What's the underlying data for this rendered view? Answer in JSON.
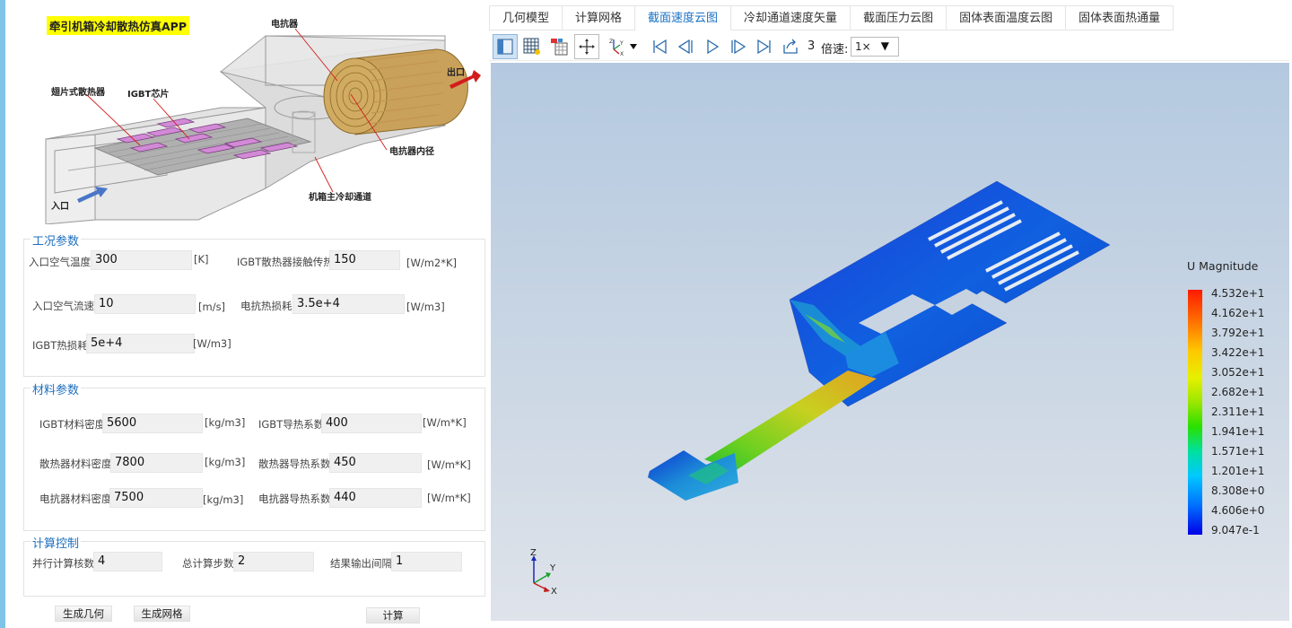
{
  "app_title": "牵引机箱冷却散热仿真APP",
  "geometry_labels": {
    "reactor": "电抗器",
    "outlet": "出口",
    "fin_heatsink": "翅片式散热器",
    "igbt_chip": "IGBT芯片",
    "reactor_inner": "电抗器内径",
    "inlet": "入口",
    "main_channel": "机箱主冷却通道"
  },
  "conditions": {
    "title": "工况参数",
    "fields": [
      {
        "label": "入口空气温度",
        "value": "300",
        "unit": "[K]"
      },
      {
        "label": "IGBT散热器接触传热",
        "value": "150",
        "unit": "[W/m2*K]"
      },
      {
        "label": "入口空气流速",
        "value": "10",
        "unit": "[m/s]"
      },
      {
        "label": "电抗热损耗",
        "value": "3.5e+4",
        "unit": "[W/m3]"
      },
      {
        "label": "IGBT热损耗",
        "value": "5e+4",
        "unit": "[W/m3]"
      }
    ]
  },
  "materials": {
    "title": "材料参数",
    "fields": [
      {
        "label": "IGBT材料密度",
        "value": "5600",
        "unit": "[kg/m3]"
      },
      {
        "label": "IGBT导热系数",
        "value": "400",
        "unit": "[W/m*K]"
      },
      {
        "label": "散热器材料密度",
        "value": "7800",
        "unit": "[kg/m3]"
      },
      {
        "label": "散热器导热系数",
        "value": "450",
        "unit": "[W/m*K]"
      },
      {
        "label": "电抗器材料密度",
        "value": "7500",
        "unit": "[kg/m3]"
      },
      {
        "label": "电抗器导热系数",
        "value": "440",
        "unit": "[W/m*K]"
      }
    ]
  },
  "compute": {
    "title": "计算控制",
    "fields": [
      {
        "label": "并行计算核数",
        "value": "4"
      },
      {
        "label": "总计算步数",
        "value": "2"
      },
      {
        "label": "结果输出间隔",
        "value": "1"
      }
    ]
  },
  "buttons": {
    "gen_geometry": "生成几何",
    "gen_mesh": "生成网格",
    "compute": "计算"
  },
  "tabs": [
    "几何模型",
    "计算网格",
    "截面速度云图",
    "冷却通道速度矢量",
    "截面压力云图",
    "固体表面温度云图",
    "固体表面热通量"
  ],
  "active_tab": 2,
  "toolbar": {
    "frame": "3",
    "speed_label": "倍速:",
    "speed_value": "1×"
  },
  "legend": {
    "title": "U Magnitude",
    "values": [
      "4.532e+1",
      "4.162e+1",
      "3.792e+1",
      "3.422e+1",
      "3.052e+1",
      "2.682e+1",
      "2.311e+1",
      "1.941e+1",
      "1.571e+1",
      "1.201e+1",
      "8.308e+0",
      "4.606e+0",
      "9.047e-1"
    ]
  },
  "axes": {
    "z": "Z",
    "y": "Y",
    "x": "X"
  },
  "colors": {
    "accent": "#1a72c4",
    "title_highlight": "#ffff00",
    "legend_max": "#ff1a00",
    "legend_min": "#0000e6"
  }
}
